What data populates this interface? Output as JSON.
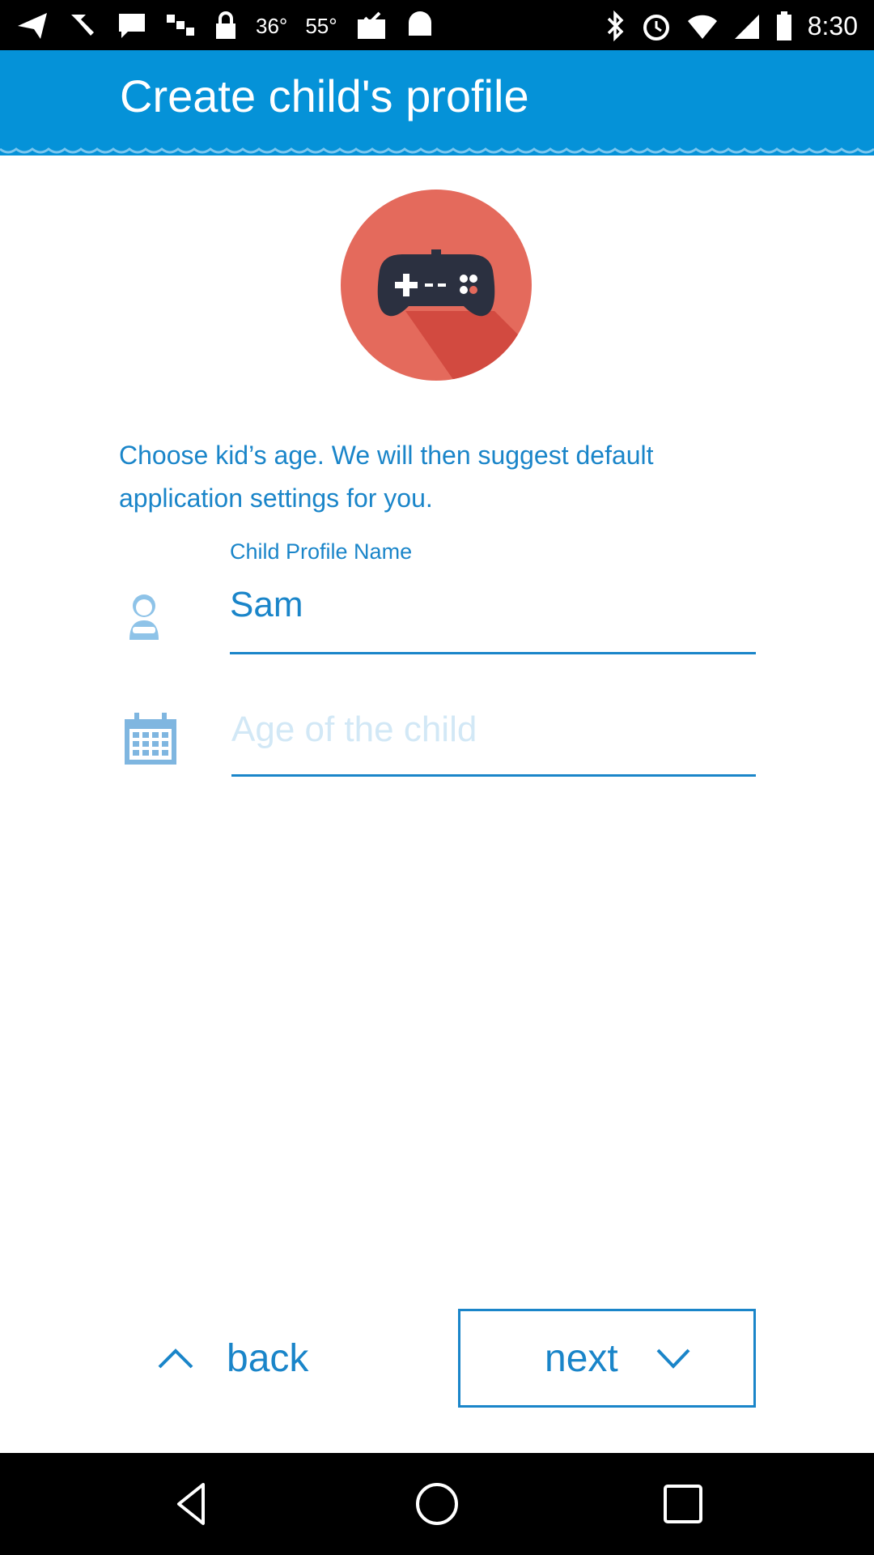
{
  "status_bar": {
    "temp_1": "36°",
    "temp_2": "55°",
    "time": "8:30"
  },
  "app_bar": {
    "title": "Create child's profile",
    "color": "#0592d8"
  },
  "intro_text": "Choose kid’s age. We will then suggest default application settings for you.",
  "form": {
    "name_label": "Child Profile Name",
    "name_value": "Sam",
    "age_placeholder": "Age of the child"
  },
  "footer": {
    "back_label": "back",
    "next_label": "next"
  },
  "colors": {
    "accent": "#1a85c9",
    "hero_red": "#e46a5c",
    "placeholder": "#d2e8f6"
  }
}
